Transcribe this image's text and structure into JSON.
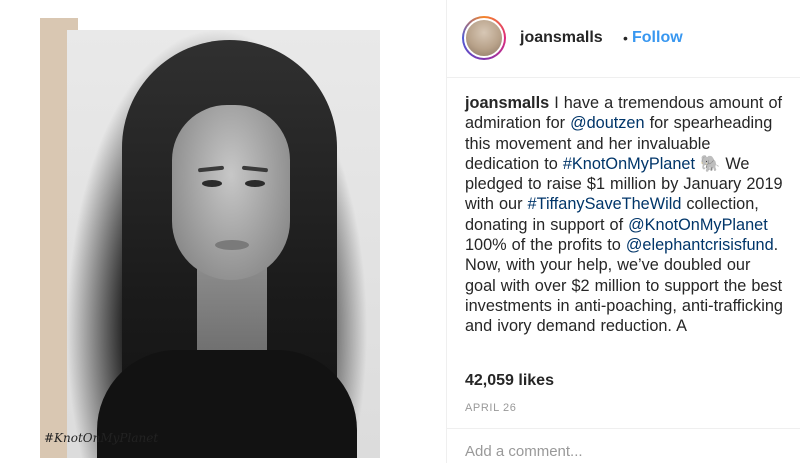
{
  "post": {
    "image_overlay_text": "#KnotOnMyPlanet"
  },
  "header": {
    "username": "joansmalls",
    "separator": "•",
    "follow_label": "Follow"
  },
  "caption": {
    "username": "joansmalls",
    "t1": " I have a tremendous amount of admiration for ",
    "m1": "@doutzen",
    "t2": " for spearheading this movement and her invaluable dedication to ",
    "h1": "#KnotOnMyPlanet",
    "emoji": " 🐘 ",
    "t3": "We pledged to raise $1 million by January 2019 with our ",
    "h2": "#TiffanySaveTheWild",
    "t4": " collection, donating in support of ",
    "m2": "@KnotOnMyPlanet",
    "t5": " 100% of the profits to ",
    "m3": "@elephantcrisisfund",
    "t6": ". Now, with your help, we’ve doubled our goal with over $2 million to support the best investments in anti-poaching, anti-trafficking and ivory demand reduction. A"
  },
  "stats": {
    "likes": "42,059 likes",
    "date": "APRIL 26"
  },
  "comment": {
    "placeholder": "Add a comment..."
  },
  "colors": {
    "link": "#003569",
    "follow": "#3897f0",
    "muted": "#999999",
    "tan_bar": "#d9c7b2"
  }
}
